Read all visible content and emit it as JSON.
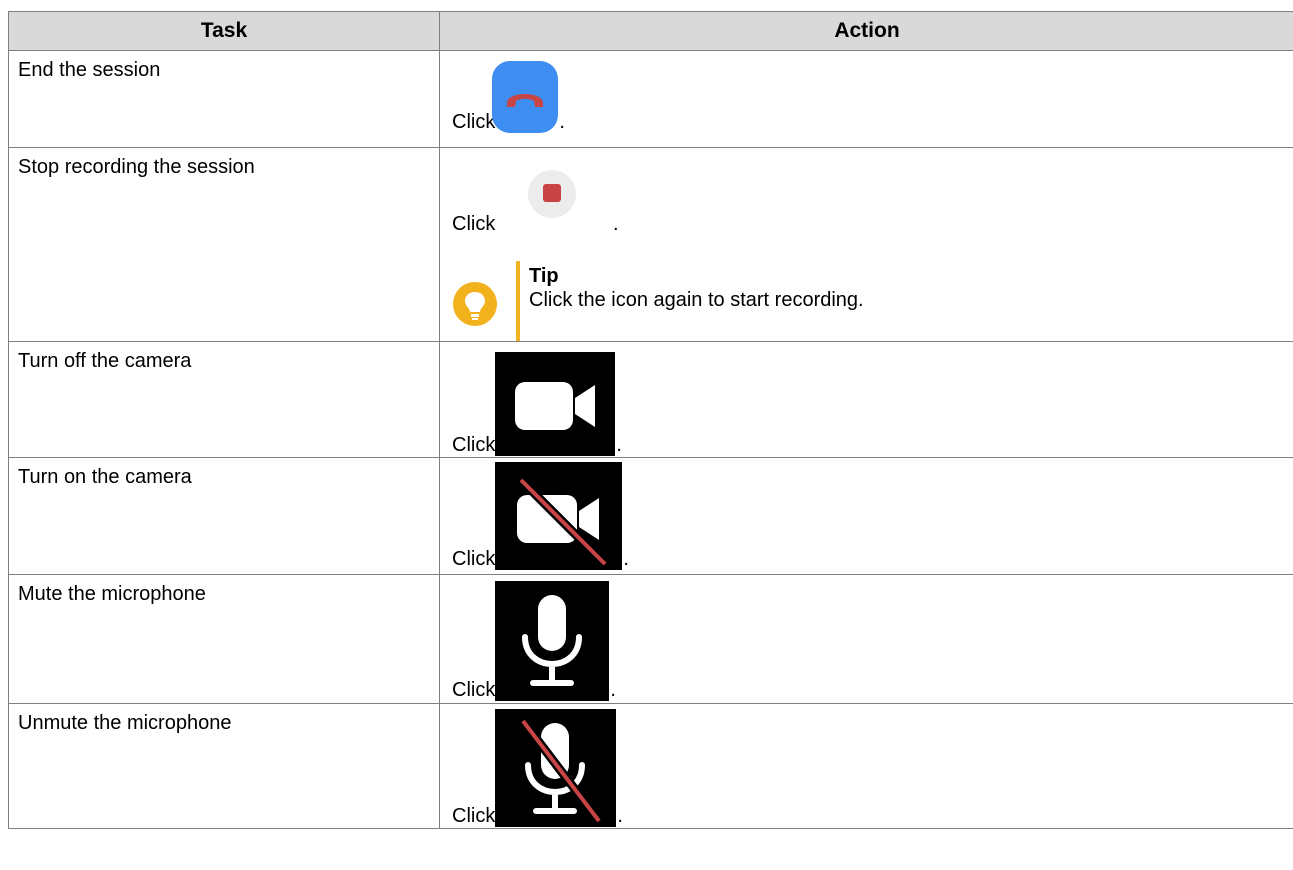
{
  "table": {
    "headers": {
      "task": "Task",
      "action": "Action"
    },
    "click_word": "Click",
    "period": ".",
    "rows": [
      {
        "task": "End the session",
        "icon": "end-call-icon"
      },
      {
        "task": "Stop recording the session",
        "icon": "stop-record-icon"
      },
      {
        "task": "Turn off the camera",
        "icon": "camera-icon"
      },
      {
        "task": "Turn on the camera",
        "icon": "camera-off-icon"
      },
      {
        "task": "Mute the microphone",
        "icon": "microphone-icon"
      },
      {
        "task": "Unmute the microphone",
        "icon": "microphone-off-icon"
      }
    ],
    "tip": {
      "title": "Tip",
      "text": "Click the icon again to start recording.",
      "icon": "lightbulb-icon"
    }
  },
  "colors": {
    "header_bg": "#d9d9d9",
    "end_button": "#3d8ef0",
    "hangup_red": "#c94545",
    "tip_accent": "#f2b21e"
  }
}
